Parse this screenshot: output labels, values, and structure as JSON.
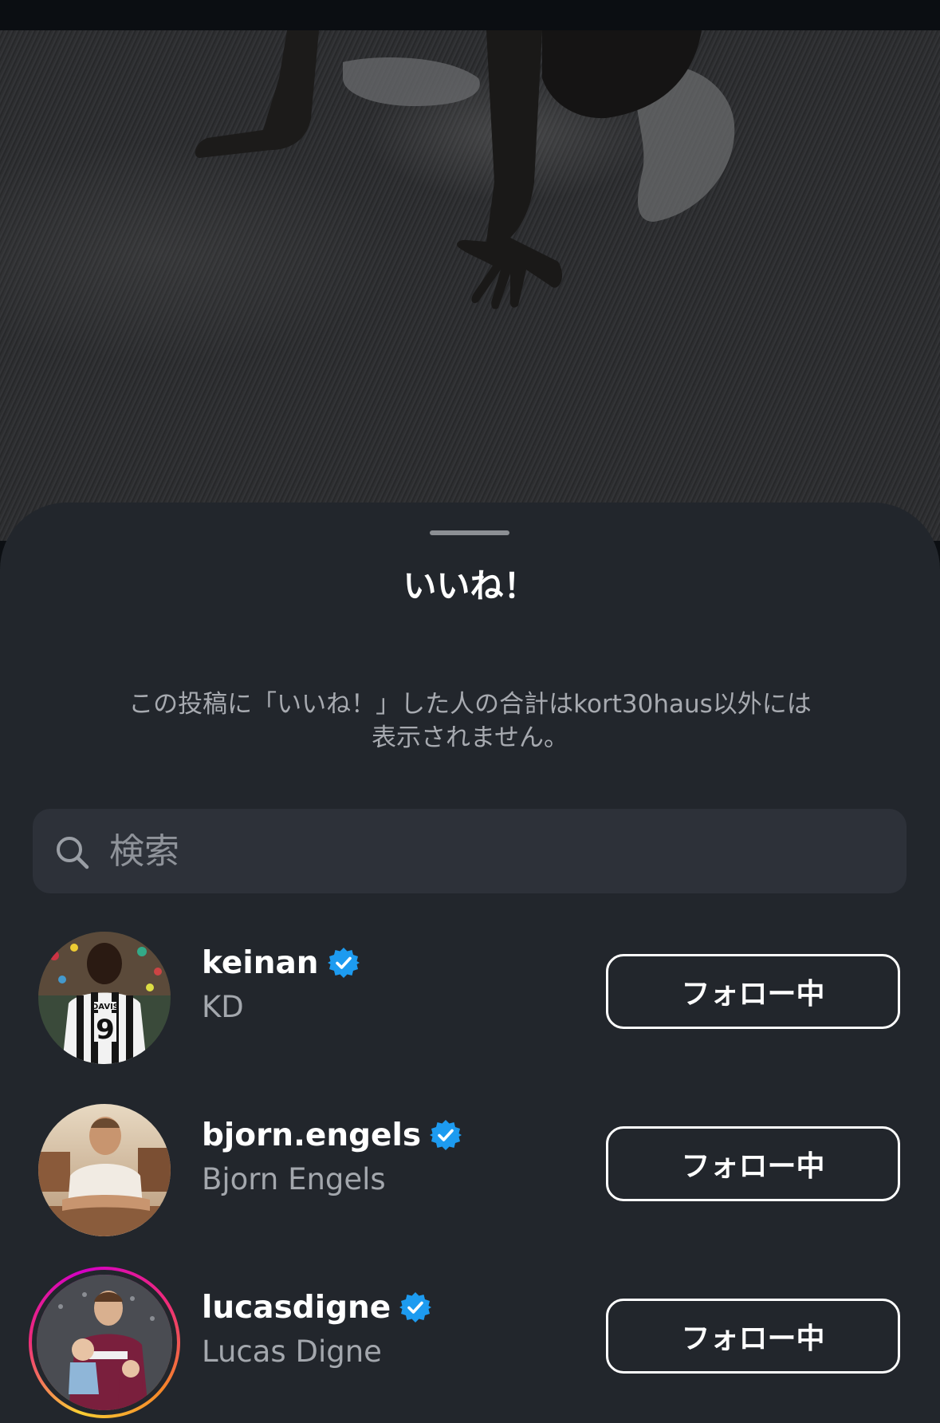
{
  "sheet": {
    "title": "いいね！",
    "notice": "この投稿に「いいね！」した人の合計はkort30haus以外には表示されません。"
  },
  "search": {
    "placeholder": "検索",
    "value": ""
  },
  "users": [
    {
      "username": "keinan",
      "full_name": "KD",
      "verified": true,
      "has_story_ring": false,
      "button_label": "フォロー中",
      "avatar_icon": "avatar-keinan"
    },
    {
      "username": "bjorn.engels",
      "full_name": "Bjorn Engels",
      "verified": true,
      "has_story_ring": false,
      "button_label": "フォロー中",
      "avatar_icon": "avatar-bjorn-engels"
    },
    {
      "username": "lucasdigne",
      "full_name": "Lucas Digne",
      "verified": true,
      "has_story_ring": true,
      "button_label": "フォロー中",
      "avatar_icon": "avatar-lucasdigne"
    }
  ],
  "icons": {
    "search": "search-icon",
    "verified": "verified-badge-icon",
    "grabber": "sheet-grabber"
  },
  "colors": {
    "sheet_background": "#22262c",
    "search_background": "#2d3139",
    "verified_blue": "#1d9bf0",
    "secondary_text": "#a3a7ad"
  }
}
